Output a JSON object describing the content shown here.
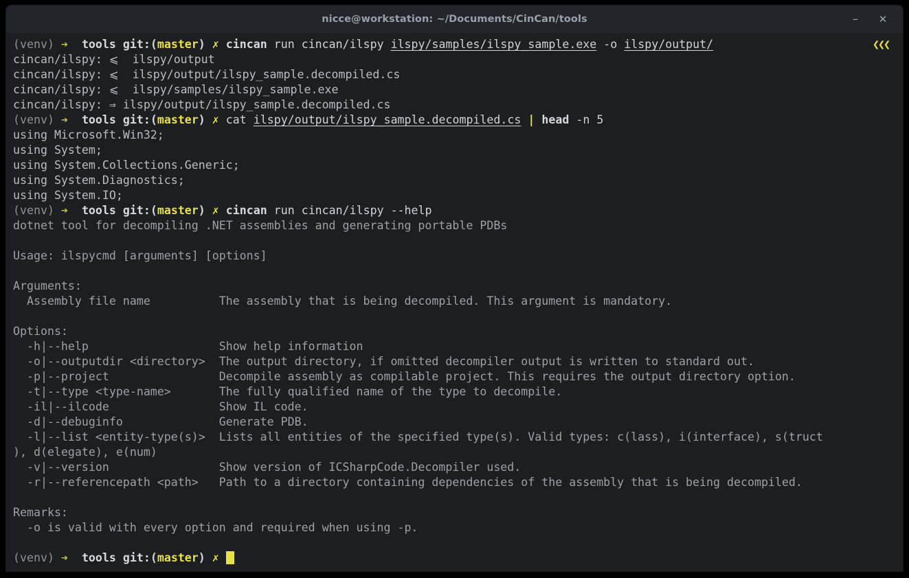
{
  "window": {
    "title": "nicce@workstation: ~/Documents/CinCan/tools",
    "minimize_label": "–",
    "close_label": "✕",
    "bg_color": "#1c1e22",
    "titlebar_color": "#22252a",
    "title_color": "#98a0a8"
  },
  "prompt": {
    "venv": "(venv)",
    "arrow": "➔",
    "dir": "tools",
    "git_open": "git:(",
    "branch": "master",
    "git_close": ")",
    "status": "✗",
    "colors": {
      "venv": "#8d9297",
      "arrow": "#d2cd4e",
      "dir": "#d6dade",
      "git": "#d6dade",
      "branch": "#e8e04a",
      "status": "#e8e04a",
      "cursor": "#e8e04a"
    }
  },
  "scroll_marker": "❮❮❮",
  "lines": [
    {
      "type": "command",
      "segments": [
        {
          "text": "cincan",
          "style": "white"
        },
        {
          "text": " run cincan/ilspy ",
          "style": "cmd"
        },
        {
          "text": "ilspy/samples/ilspy_sample.exe",
          "style": "cmd-underline"
        },
        {
          "text": " -o ",
          "style": "cmd"
        },
        {
          "text": "ilspy/output/",
          "style": "cmd-underline"
        }
      ]
    },
    {
      "type": "output",
      "text": "cincan/ilspy: ⩽  ilspy/output"
    },
    {
      "type": "output",
      "text": "cincan/ilspy: ⩽  ilspy/output/ilspy_sample.decompiled.cs"
    },
    {
      "type": "output",
      "text": "cincan/ilspy: ⩽  ilspy/samples/ilspy_sample.exe"
    },
    {
      "type": "output",
      "text": "cincan/ilspy: ⇒ ilspy/output/ilspy_sample.decompiled.cs"
    },
    {
      "type": "command",
      "segments": [
        {
          "text": "cat ",
          "style": "cmd"
        },
        {
          "text": "ilspy/output/ilspy_sample.decompiled.cs",
          "style": "cmd-underline"
        },
        {
          "text": " ",
          "style": "cmd"
        },
        {
          "text": "|",
          "style": "yellow"
        },
        {
          "text": " ",
          "style": "cmd"
        },
        {
          "text": "head",
          "style": "white"
        },
        {
          "text": " -n 5",
          "style": "cmd"
        }
      ]
    },
    {
      "type": "output",
      "text": "using Microsoft.Win32;"
    },
    {
      "type": "output",
      "text": "using System;"
    },
    {
      "type": "output",
      "text": "using System.Collections.Generic;"
    },
    {
      "type": "output",
      "text": "using System.Diagnostics;"
    },
    {
      "type": "output",
      "text": "using System.IO;"
    },
    {
      "type": "command",
      "segments": [
        {
          "text": "cincan",
          "style": "white"
        },
        {
          "text": " run cincan/ilspy --help",
          "style": "cmd"
        }
      ]
    },
    {
      "type": "help",
      "text": "dotnet tool for decompiling .NET assemblies and generating portable PDBs"
    },
    {
      "type": "help",
      "text": ""
    },
    {
      "type": "help",
      "text": "Usage: ilspycmd [arguments] [options]"
    },
    {
      "type": "help",
      "text": ""
    },
    {
      "type": "help",
      "text": "Arguments:"
    },
    {
      "type": "help",
      "text": "  Assembly file name          The assembly that is being decompiled. This argument is mandatory."
    },
    {
      "type": "help",
      "text": ""
    },
    {
      "type": "help",
      "text": "Options:"
    },
    {
      "type": "help",
      "text": "  -h|--help                   Show help information"
    },
    {
      "type": "help",
      "text": "  -o|--outputdir <directory>  The output directory, if omitted decompiler output is written to standard out."
    },
    {
      "type": "help",
      "text": "  -p|--project                Decompile assembly as compilable project. This requires the output directory option."
    },
    {
      "type": "help",
      "text": "  -t|--type <type-name>       The fully qualified name of the type to decompile."
    },
    {
      "type": "help",
      "text": "  -il|--ilcode                Show IL code."
    },
    {
      "type": "help",
      "text": "  -d|--debuginfo              Generate PDB."
    },
    {
      "type": "help",
      "text": "  -l|--list <entity-type(s)>  Lists all entities of the specified type(s). Valid types: c(lass), i(interface), s(truct"
    },
    {
      "type": "help",
      "text": "), d(elegate), e(num)"
    },
    {
      "type": "help",
      "text": "  -v|--version                Show version of ICSharpCode.Decompiler used."
    },
    {
      "type": "help",
      "text": "  -r|--referencepath <path>   Path to a directory containing dependencies of the assembly that is being decompiled."
    },
    {
      "type": "help",
      "text": ""
    },
    {
      "type": "help",
      "text": "Remarks:"
    },
    {
      "type": "help",
      "text": "  -o is valid with every option and required when using -p."
    },
    {
      "type": "help",
      "text": ""
    },
    {
      "type": "prompt-cursor"
    }
  ]
}
